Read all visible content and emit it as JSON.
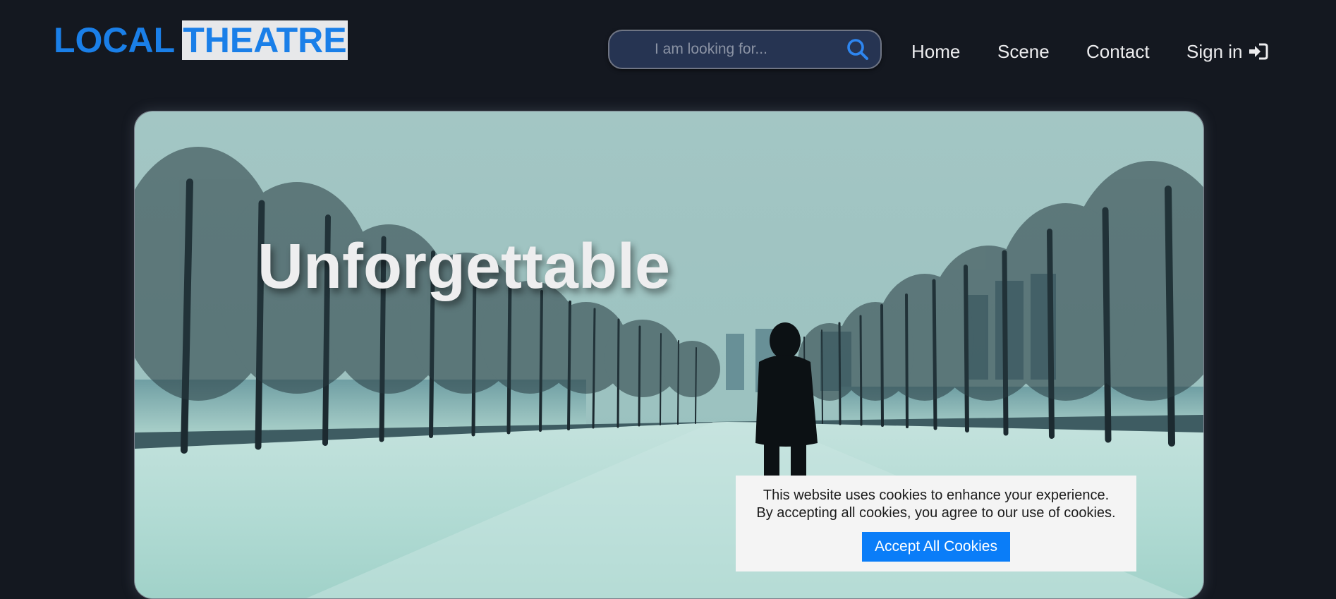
{
  "header": {
    "logo_part1": "LOCAL",
    "logo_part2": "THEATRE",
    "search": {
      "placeholder": "I am looking for...",
      "icon": "search-icon"
    },
    "nav": [
      {
        "label": "Home"
      },
      {
        "label": "Scene"
      },
      {
        "label": "Contact"
      },
      {
        "label": "Sign in",
        "icon": "sign-in-icon"
      }
    ]
  },
  "hero": {
    "title": "Unforgettable"
  },
  "cookie_banner": {
    "line1": "This website uses cookies to enhance your experience.",
    "line2": "By accepting all cookies, you agree to our use of cookies.",
    "button_label": "Accept All Cookies"
  },
  "colors": {
    "page_background": "#141820",
    "brand_blue": "#1a7fe8",
    "search_background": "#263452",
    "button_blue": "#0a7df8"
  }
}
